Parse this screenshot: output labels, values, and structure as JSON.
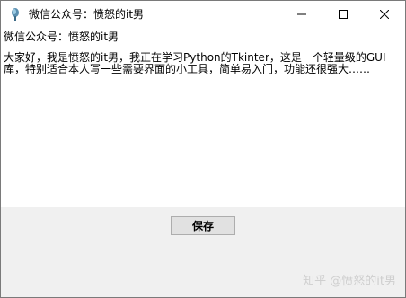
{
  "window": {
    "title": "微信公众号：愤怒的it男"
  },
  "titlebar_buttons": {
    "minimize": "minimize",
    "maximize": "maximize",
    "close": "close"
  },
  "content": {
    "label": "微信公众号：愤怒的it男",
    "text": "大家好，我是愤怒的it男，我正在学习Python的Tkinter，这是一个轻量级的GUI库，特别适合本人写一些需要界面的小工具，简单易入门，功能还很强大……"
  },
  "buttons": {
    "save_label": "保存"
  },
  "watermark": "知乎 @愤怒的it男"
}
